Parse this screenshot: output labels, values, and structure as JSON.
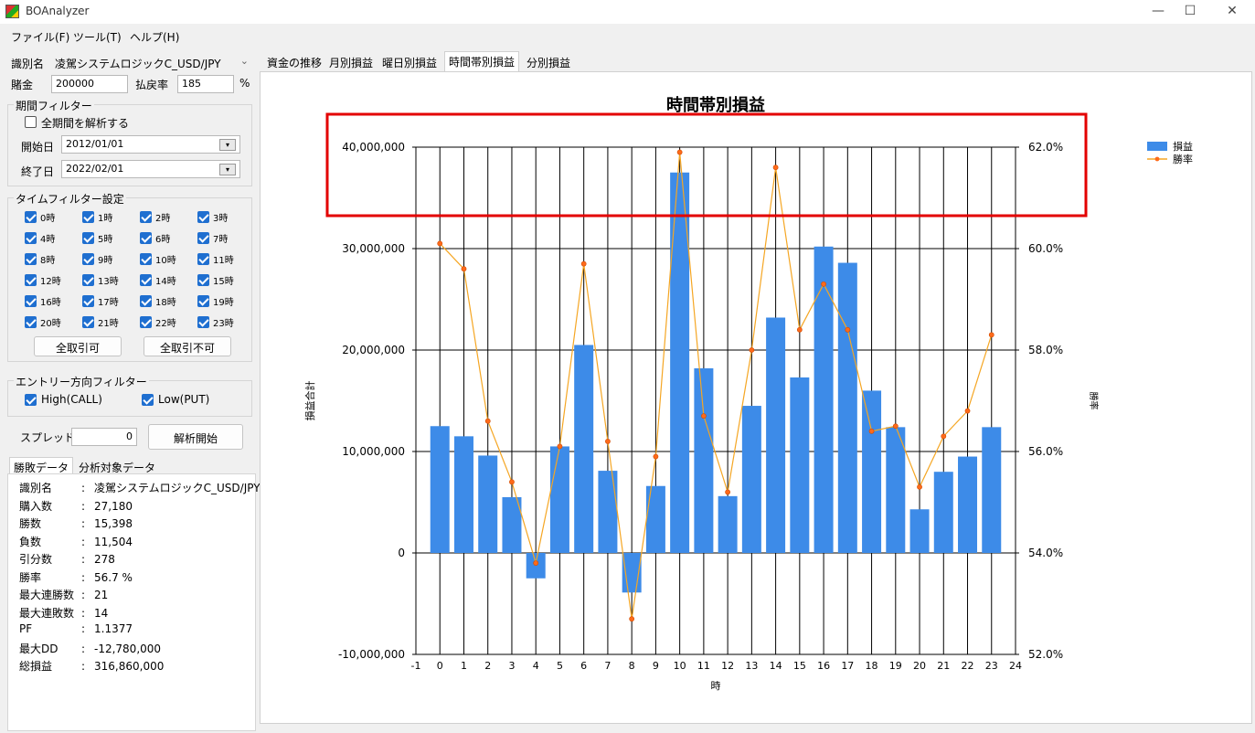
{
  "window": {
    "title": "BOAnalyzer",
    "minimize": "—",
    "maximize": "☐",
    "close": "✕"
  },
  "menu": [
    "ファイル(F)",
    "ツール(T)",
    "ヘルプ(H)"
  ],
  "form": {
    "id_label": "識別名",
    "id_value": "凌駕システムロジックC_USD/JPY",
    "bet_label": "賭金",
    "bet_value": "200000",
    "payout_label": "払戻率",
    "payout_value": "185",
    "percent": "%"
  },
  "period_filter": {
    "title": "期間フィルター",
    "all_label": "全期間を解析する",
    "start_label": "開始日",
    "start_value": "2012/01/01",
    "end_label": "終了日",
    "end_value": "2022/02/01"
  },
  "time_filter": {
    "title": "タイムフィルター設定",
    "hours": [
      "0時",
      "1時",
      "2時",
      "3時",
      "4時",
      "5時",
      "6時",
      "7時",
      "8時",
      "9時",
      "10時",
      "11時",
      "12時",
      "13時",
      "14時",
      "15時",
      "16時",
      "17時",
      "18時",
      "19時",
      "20時",
      "21時",
      "22時",
      "23時"
    ],
    "allow_all": "全取引可",
    "deny_all": "全取引不可"
  },
  "direction_filter": {
    "title": "エントリー方向フィルター",
    "high": "High(CALL)",
    "low": "Low(PUT)"
  },
  "spread": {
    "label": "スプレッド",
    "value": "0",
    "run": "解析開始"
  },
  "stats_tabs": [
    "勝敗データ",
    "分析対象データ"
  ],
  "stats": [
    {
      "k": "識別名",
      "v": "凌駕システムロジックC_USD/JPY"
    },
    {
      "k": "購入数",
      "v": "27,180"
    },
    {
      "k": "勝数",
      "v": "15,398"
    },
    {
      "k": "負数",
      "v": "11,504"
    },
    {
      "k": "引分数",
      "v": "278"
    },
    {
      "k": "勝率",
      "v": "56.7 %"
    },
    {
      "k": "最大連勝数",
      "v": "21"
    },
    {
      "k": "最大連敗数",
      "v": "14"
    },
    {
      "k": "PF",
      "v": "1.1377"
    },
    {
      "k": "最大DD",
      "v": "-12,780,000"
    },
    {
      "k": "総損益",
      "v": "316,860,000"
    }
  ],
  "chart_tabs": [
    "資金の推移",
    "月別損益",
    "曜日別損益",
    "時間帯別損益",
    "分別損益"
  ],
  "chart_data": {
    "type": "bar",
    "title": "時間帯別損益",
    "xlabel": "時",
    "ylabel": "損益合計",
    "y2label": "勝率",
    "x": [
      0,
      1,
      2,
      3,
      4,
      5,
      6,
      7,
      8,
      9,
      10,
      11,
      12,
      13,
      14,
      15,
      16,
      17,
      18,
      19,
      20,
      21,
      22,
      23
    ],
    "xlim": [
      -1,
      24
    ],
    "ylim": [
      -10000000,
      40000000
    ],
    "y2lim": [
      52.0,
      62.0
    ],
    "yticks": [
      "-10,000,000",
      "0",
      "10,000,000",
      "20,000,000",
      "30,000,000",
      "40,000,000"
    ],
    "y2ticks": [
      "52.0%",
      "54.0%",
      "56.0%",
      "58.0%",
      "60.0%",
      "62.0%"
    ],
    "legend_position": "top-right",
    "series": [
      {
        "name": "損益",
        "type": "bar",
        "color": "#3d8be8",
        "values": [
          12500000,
          11500000,
          9600000,
          5500000,
          -2500000,
          10500000,
          20500000,
          8100000,
          -3900000,
          6600000,
          37500000,
          18200000,
          5600000,
          14500000,
          23200000,
          17300000,
          30200000,
          28600000,
          16000000,
          12400000,
          4300000,
          8000000,
          9500000,
          12400000
        ]
      },
      {
        "name": "勝率",
        "type": "line",
        "color": "#f5a623",
        "values": [
          60.1,
          59.6,
          56.6,
          55.4,
          53.8,
          56.1,
          59.7,
          56.2,
          52.7,
          55.9,
          61.9,
          56.7,
          55.2,
          58.0,
          61.6,
          58.4,
          59.3,
          58.4,
          56.4,
          56.5,
          55.3,
          56.3,
          56.8,
          58.3
        ]
      }
    ]
  }
}
